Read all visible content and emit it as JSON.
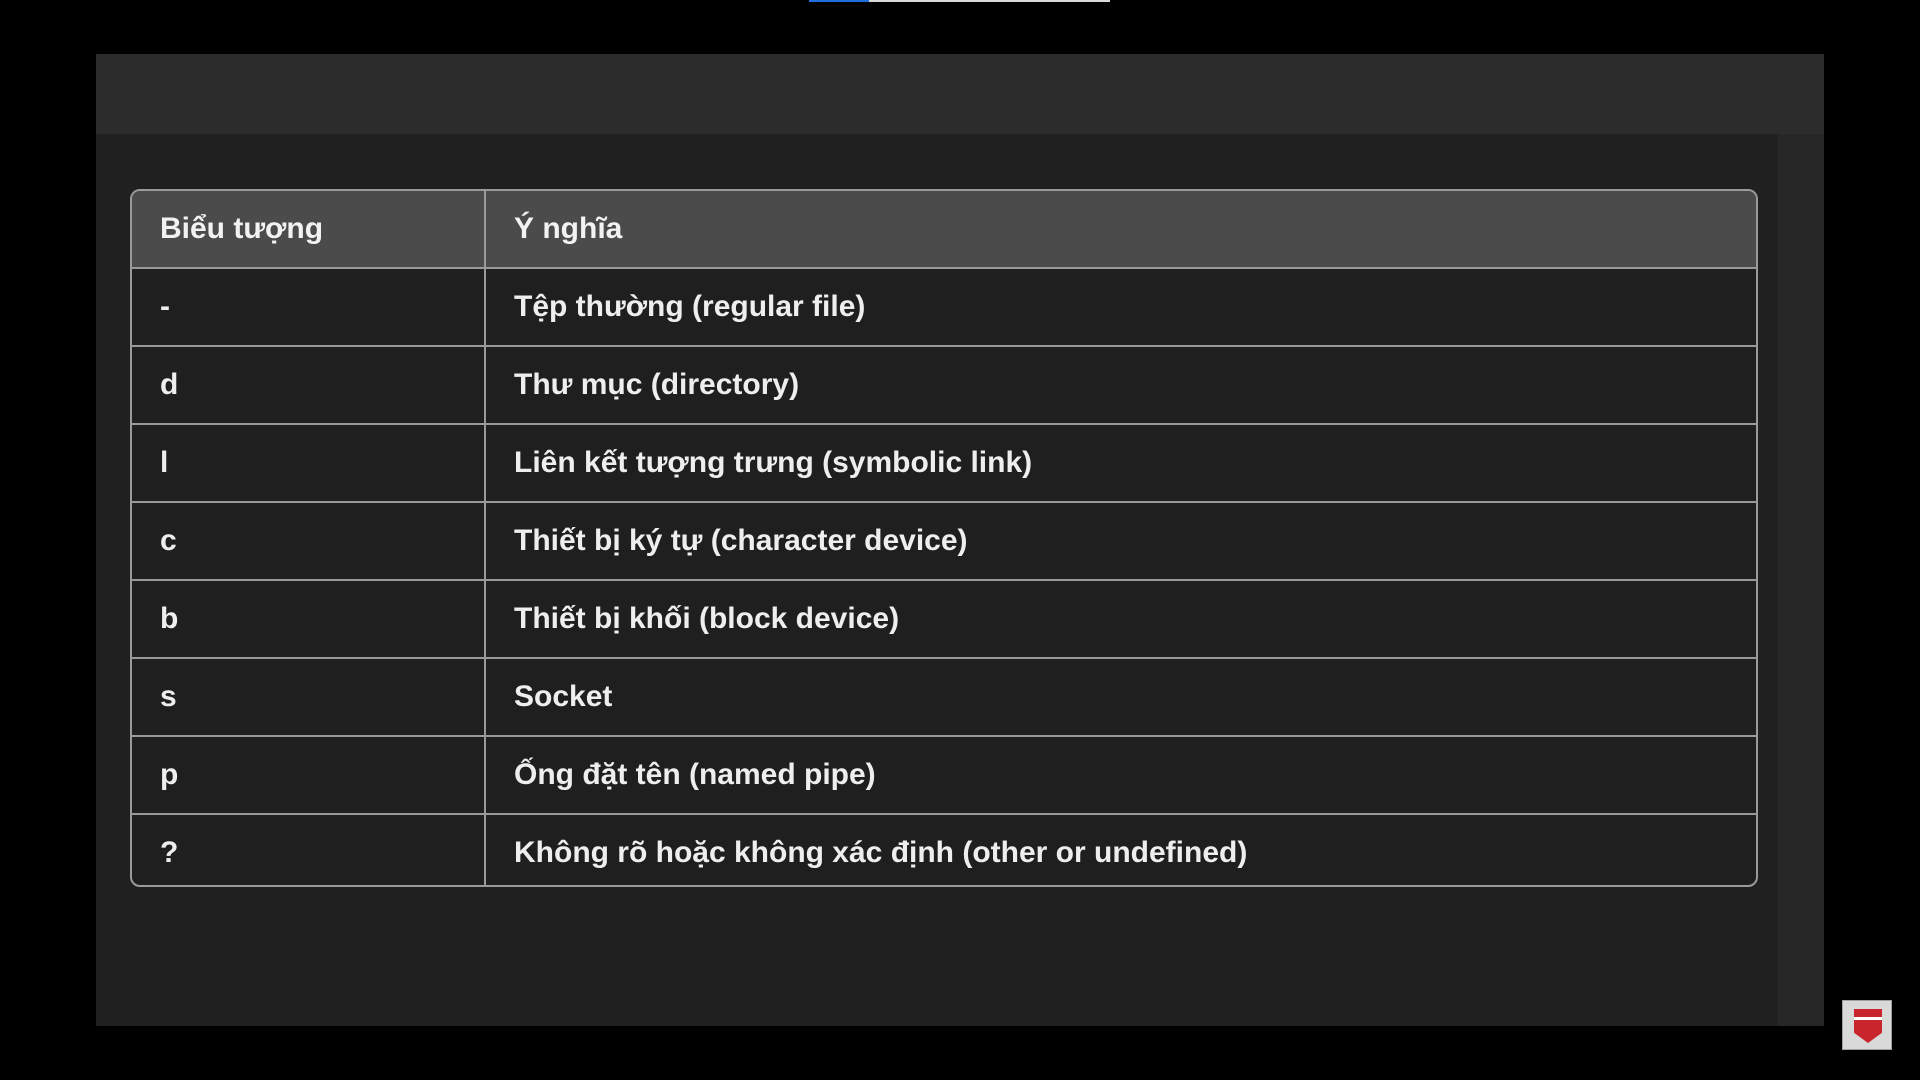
{
  "table": {
    "headers": [
      "Biểu tượng",
      "Ý nghĩa"
    ],
    "rows": [
      {
        "symbol": "-",
        "meaning": "Tệp thường (regular file)"
      },
      {
        "symbol": "d",
        "meaning": "Thư mục (directory)"
      },
      {
        "symbol": "l",
        "meaning": "Liên kết tượng trưng (symbolic link)"
      },
      {
        "symbol": "c",
        "meaning": "Thiết bị ký tự (character device)"
      },
      {
        "symbol": "b",
        "meaning": "Thiết bị khối (block device)"
      },
      {
        "symbol": "s",
        "meaning": "Socket"
      },
      {
        "symbol": "p",
        "meaning": "Ống đặt tên (named pipe)"
      },
      {
        "symbol": "?",
        "meaning": "Không rõ hoặc không xác định (other or undefined)"
      }
    ]
  },
  "colors": {
    "background": "#000000",
    "panel": "#262626",
    "header_fill": "#4b4b4b",
    "border": "#9a9a9a",
    "progress_accent": "#1e6fd9",
    "logo_red": "#c8252c"
  },
  "icons": {
    "corner_logo": "channel-logo-icon"
  }
}
